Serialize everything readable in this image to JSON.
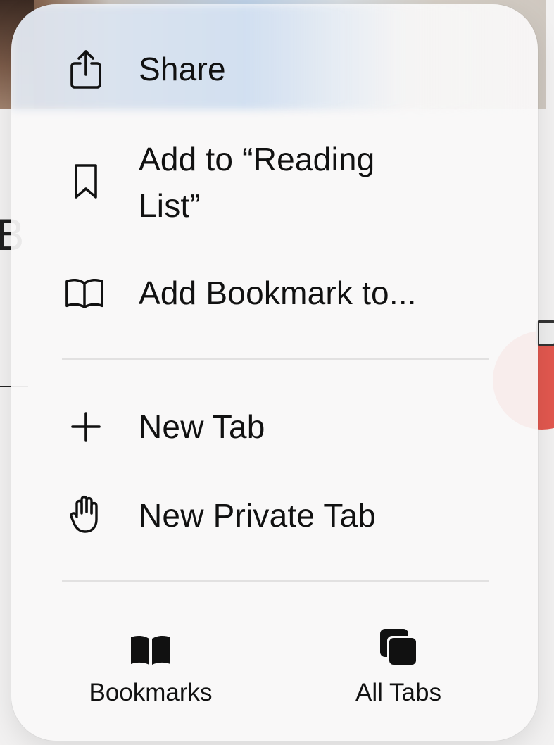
{
  "menu": {
    "items": [
      {
        "label": "Share",
        "icon": "share-icon"
      },
      {
        "label": "Add to “Reading List”",
        "line1": "Add to “Reading",
        "line2": "List”",
        "icon": "bookmark-ribbon-icon"
      },
      {
        "label": "Add Bookmark to...",
        "icon": "open-book-icon"
      },
      {
        "label": "New Tab",
        "icon": "plus-icon"
      },
      {
        "label": "New Private Tab",
        "icon": "hand-icon"
      }
    ],
    "bottom": [
      {
        "label": "Bookmarks",
        "icon": "book-filled-icon"
      },
      {
        "label": "All Tabs",
        "icon": "tabs-stack-icon"
      }
    ]
  },
  "colors": {
    "text": "#111111",
    "separator": "#e2e1e1",
    "menu_bg": "#faf9f9"
  }
}
